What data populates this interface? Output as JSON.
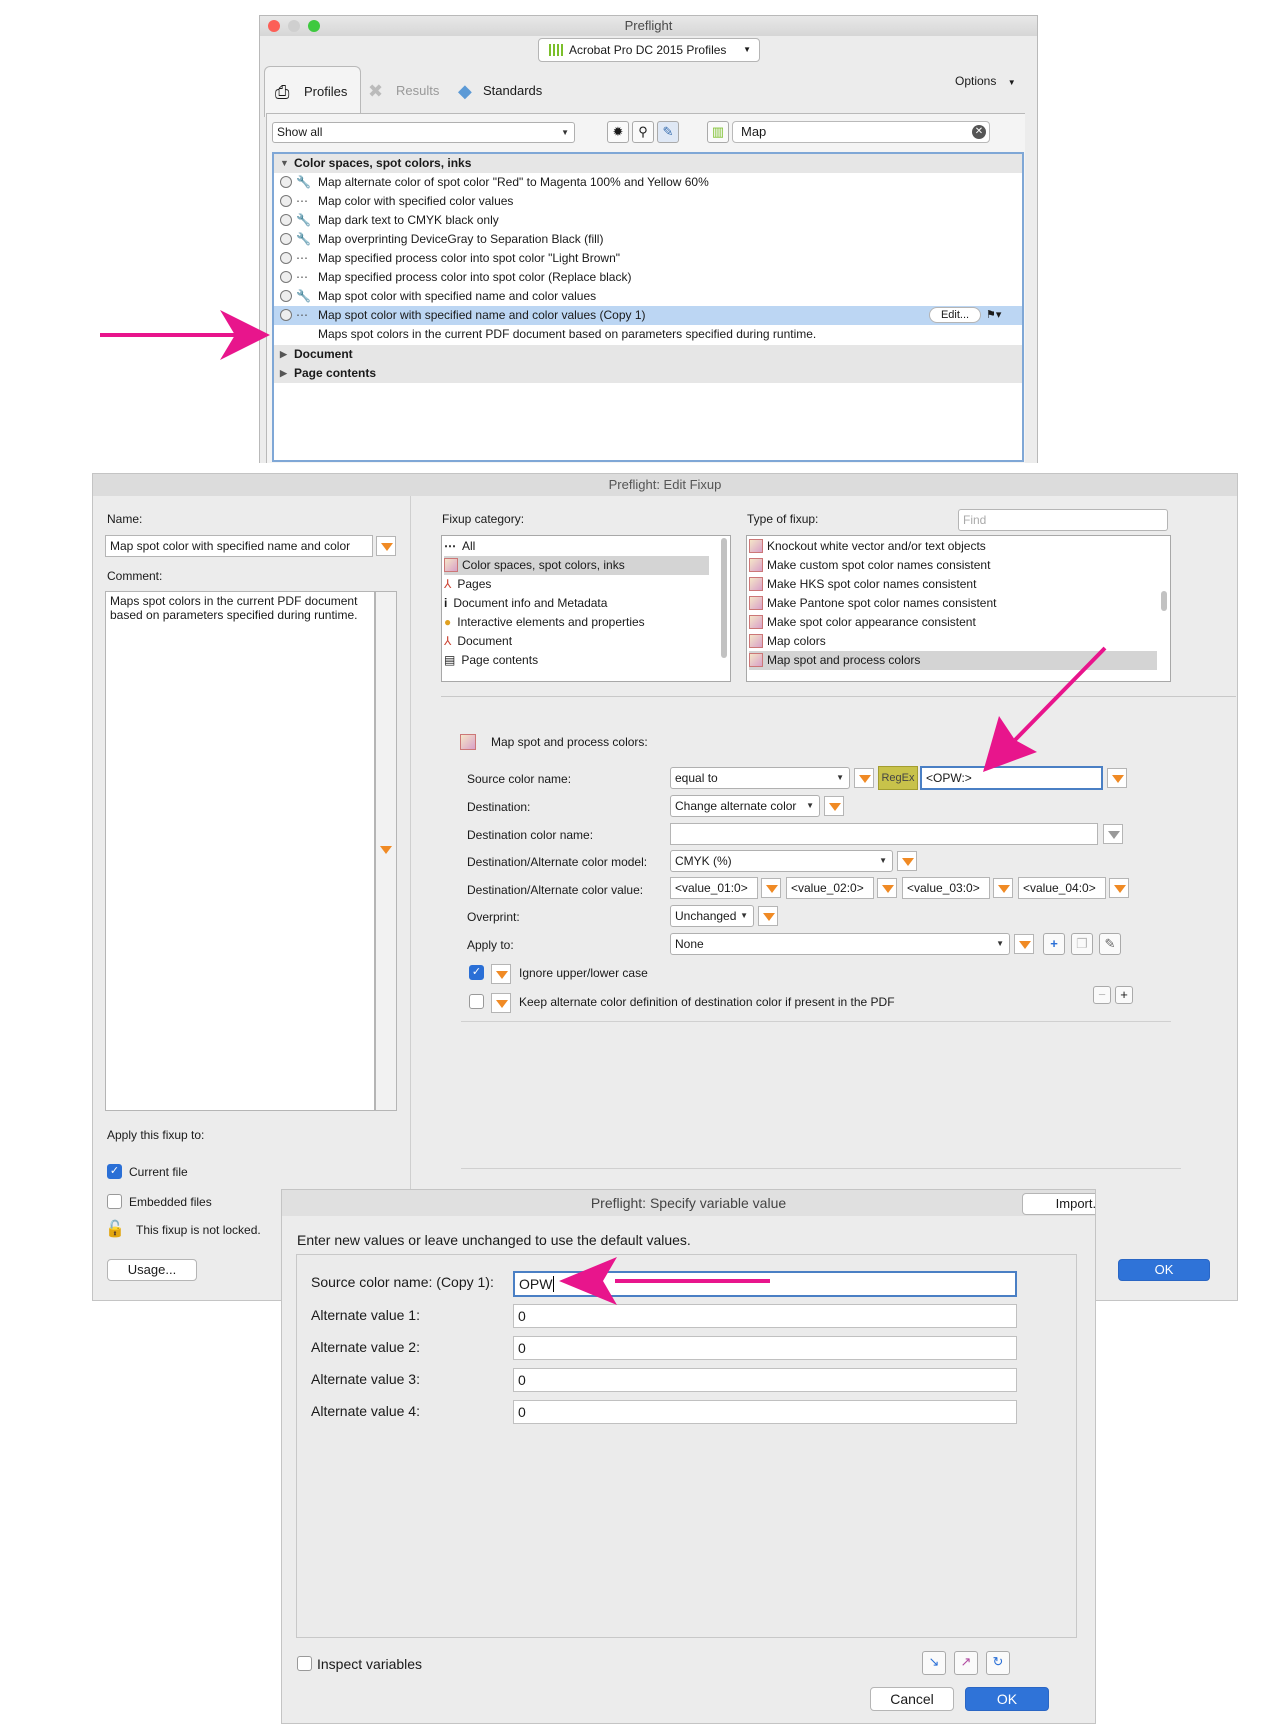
{
  "preflight": {
    "title": "Preflight",
    "profile_set": "Acrobat Pro DC 2015 Profiles",
    "tabs": [
      {
        "label": "Profiles"
      },
      {
        "label": "Results"
      },
      {
        "label": "Standards"
      }
    ],
    "options_label": "Options",
    "filter_value": "Show all",
    "search_value": "Map",
    "category_open": "Color spaces, spot colors, inks",
    "items": [
      "Map alternate color of spot color \"Red\" to Magenta 100% and Yellow 60%",
      "Map color with specified color values",
      "Map dark text to CMYK black only",
      "Map overprinting DeviceGray to Separation Black (fill)",
      "Map specified process color into spot color \"Light Brown\"",
      "Map specified process color into spot color (Replace black)",
      "Map spot color with specified name and color values",
      "Map spot color with specified name and color values (Copy 1)"
    ],
    "selected_description": "Maps spot colors in the current PDF document based on parameters specified during runtime.",
    "edit_label": "Edit...",
    "other_categories": [
      "Document",
      "Page contents"
    ]
  },
  "edit_fixup": {
    "title": "Preflight: Edit Fixup",
    "name_label": "Name:",
    "name_value": "Map spot color with specified name and color",
    "comment_label": "Comment:",
    "comment_value": "Maps spot colors in the current PDF document based on parameters specified during runtime.",
    "fixup_category_label": "Fixup category:",
    "categories": [
      "All",
      "Color spaces, spot colors, inks",
      "Pages",
      "Document info and Metadata",
      "Interactive elements and properties",
      "Document",
      "Page contents"
    ],
    "type_label": "Type of fixup:",
    "find_placeholder": "Find",
    "types": [
      "Knockout white vector and/or text objects",
      "Make custom spot color names consistent",
      "Make HKS spot color names consistent",
      "Make Pantone spot color names consistent",
      "Make spot color appearance consistent",
      "Map colors",
      "Map spot and process colors"
    ],
    "section_title": "Map spot and process colors:",
    "source_color_name_label": "Source color name:",
    "source_op": "equal to",
    "regex_label": "RegEx",
    "source_value": "<OPW:>",
    "destination_label": "Destination:",
    "destination_value": "Change alternate color",
    "dest_color_name_label": "Destination color name:",
    "dest_model_label": "Destination/Alternate color model:",
    "dest_model_value": "CMYK (%)",
    "dest_value_label": "Destination/Alternate color value:",
    "dest_values": [
      "<value_01:0>",
      "<value_02:0>",
      "<value_03:0>",
      "<value_04:0>"
    ],
    "overprint_label": "Overprint:",
    "overprint_value": "Unchanged",
    "apply_to_label": "Apply to:",
    "apply_to_value": "None",
    "ignore_case_label": "Ignore upper/lower case",
    "keep_alt_label": "Keep alternate color definition of destination color if present in the PDF",
    "apply_fixup_label": "Apply this fixup to:",
    "current_file_label": "Current file",
    "embedded_files_label": "Embedded files",
    "not_locked_label": "This fixup is not locked.",
    "usage_label": "Usage...",
    "ok_label": "OK"
  },
  "variable_dialog": {
    "title": "Preflight: Specify variable value",
    "import_label": "Import...",
    "instruction": "Enter new values or leave unchanged to use the default values.",
    "fields": [
      {
        "label": "Source color name: (Copy 1):",
        "value": "OPW"
      },
      {
        "label": "Alternate value 1:",
        "value": "0"
      },
      {
        "label": "Alternate value 2:",
        "value": "0"
      },
      {
        "label": "Alternate value 3:",
        "value": "0"
      },
      {
        "label": "Alternate value 4:",
        "value": "0"
      }
    ],
    "inspect_label": "Inspect variables",
    "cancel_label": "Cancel",
    "ok_label": "OK"
  },
  "colors": {
    "annotation_arrow": "#e8158c",
    "selection": "#bcd6f3",
    "accent_blue": "#2f73d8",
    "orange_menu": "#f08a24"
  }
}
